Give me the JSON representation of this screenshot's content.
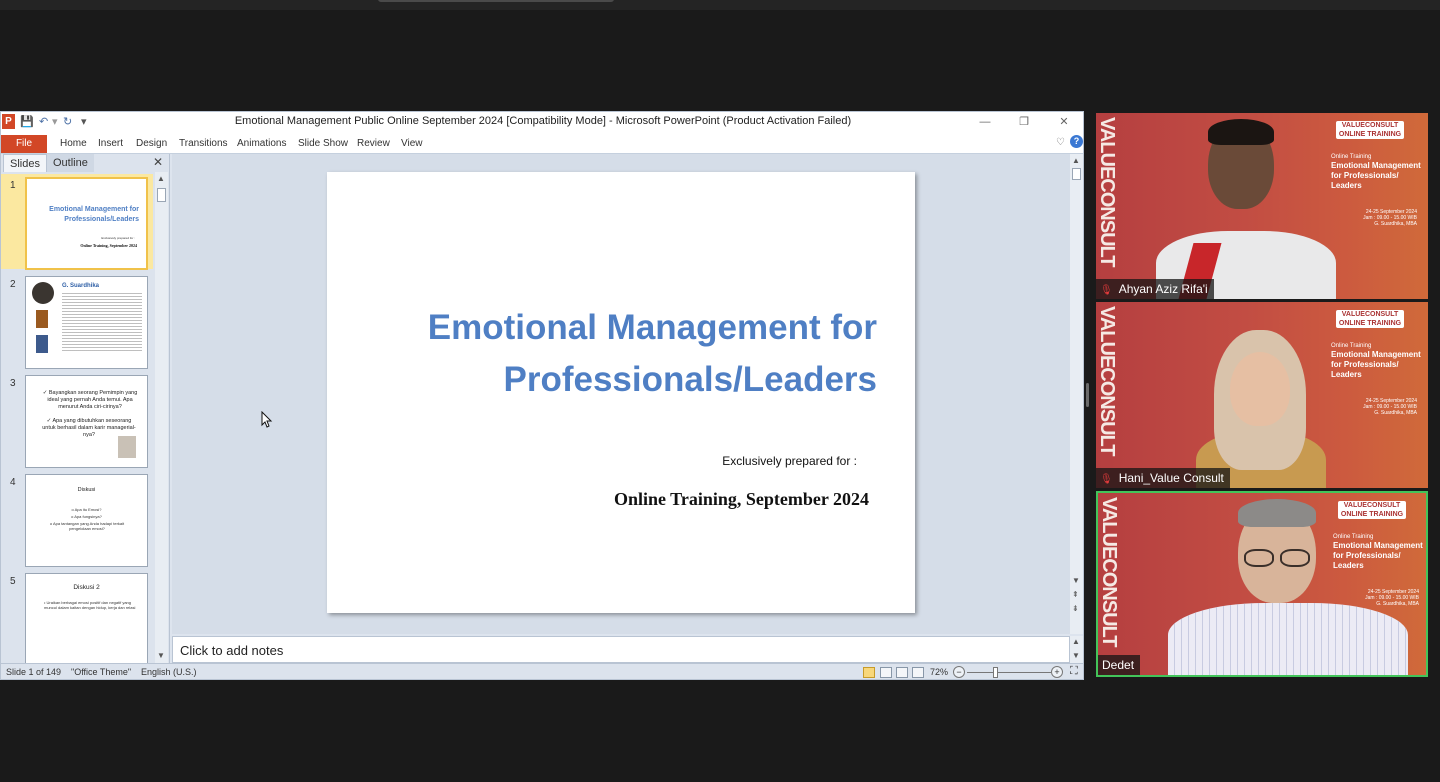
{
  "window": {
    "title": "Emotional Management Public Online September 2024 [Compatibility Mode]  -  Microsoft PowerPoint (Product Activation Failed)"
  },
  "ribbon": {
    "file": "File",
    "tabs": [
      "Home",
      "Insert",
      "Design",
      "Transitions",
      "Animations",
      "Slide Show",
      "Review",
      "View"
    ]
  },
  "pane": {
    "tabs": [
      "Slides",
      "Outline"
    ],
    "thumbs": [
      {
        "num": "1",
        "title": "Emotional Management for Professionals/Leaders",
        "line1": "Exclusively prepared for :",
        "line2": "Online Training, September 2024"
      },
      {
        "num": "2",
        "title": "G. Suardhika"
      },
      {
        "num": "3",
        "line1": "✓ Bayangkan seorang Pemimpin yang ideal yang pernah Anda temui. Apa menurut Anda ciri-cirinya?",
        "line2": "✓ Apa yang dibutuhkan seseorang untuk berhasil dalam karir managerial-nya?"
      },
      {
        "num": "4",
        "title": "Diskusi",
        "line1": "o Apa itu Emosi?",
        "line2": "o Apa fungsinya?",
        "line3": "o Apa tantangan yang Anda hadapi terkait pengelolaan emosi?"
      },
      {
        "num": "5",
        "title": "Diskusi 2",
        "line1": "• Uraikan berbagai emosi positif dan negatif yang muncul  dalam kaitan dengan hidup, kerja dan relasi"
      }
    ]
  },
  "slide": {
    "title_line1": "Emotional Management for",
    "title_line2": "Professionals/Leaders",
    "subtitle": "Exclusively  prepared for :",
    "event": "Online Training, September 2024"
  },
  "notes": {
    "placeholder": "Click to add notes"
  },
  "status": {
    "slide": "Slide 1 of 149",
    "theme": "\"Office Theme\"",
    "language": "English (U.S.)",
    "zoom": "72%"
  },
  "participants": [
    {
      "name": "Ahyan Aziz Rifa'i",
      "muted": true
    },
    {
      "name": "Hani_Value Consult",
      "muted": true
    },
    {
      "name": "Dedet",
      "muted": false,
      "active_speaker": true
    }
  ],
  "tile_background": {
    "vertical_text": "VALUECONSULT",
    "brand_top": "VALUECONSULT",
    "brand_bottom": "ONLINE TRAINING",
    "kicker": "Online Training",
    "heading": "Emotional Management for Professionals/ Leaders",
    "dates": "24-25 September 2024",
    "time": "Jam : 09.00 - 15.00 WIB",
    "trainer": "G. Suardhika, MBA"
  },
  "colors": {
    "slide_title": "#4f7fc4",
    "file_tab": "#d24726",
    "active_speaker_border": "#43c45a",
    "tile_red": "#b53f40"
  }
}
